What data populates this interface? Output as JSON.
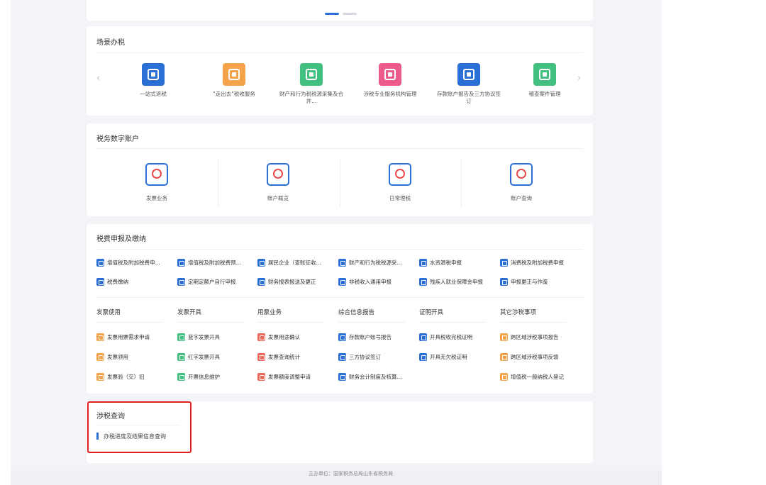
{
  "carousel": {
    "dots": [
      {
        "color": "#2a6fd6"
      },
      {
        "color": "#d4d8de"
      }
    ]
  },
  "scene": {
    "title": "场景办税",
    "items": [
      {
        "label": "一站式退税",
        "icon": "tax-refund-icon",
        "color": "#2a6fd6"
      },
      {
        "label": "\"走出去\"税收服务",
        "icon": "going-global-icon",
        "color": "#f5a34a"
      },
      {
        "label": "财产和行为税税源采集及合并...",
        "icon": "property-tax-icon",
        "color": "#42c07f"
      },
      {
        "label": "涉税专业服务机构管理",
        "icon": "institution-icon",
        "color": "#ec5a8e"
      },
      {
        "label": "存款账户报告及三方协议签订",
        "icon": "bank-account-icon",
        "color": "#2a6fd6"
      },
      {
        "label": "稽查案件管理",
        "icon": "case-management-icon",
        "color": "#42c07f"
      }
    ],
    "prev": "‹",
    "next": "›"
  },
  "account": {
    "title": "税务数字账户",
    "items": [
      {
        "label": "发票业务",
        "icon": "invoice-business-icon"
      },
      {
        "label": "账户概览",
        "icon": "account-overview-icon"
      },
      {
        "label": "日常理税",
        "icon": "daily-tax-icon"
      },
      {
        "label": "账户查询",
        "icon": "account-query-icon"
      }
    ]
  },
  "declare": {
    "title": "税费申报及缴纳",
    "row1": [
      {
        "label": "增值税及附加税费申...",
        "color": "#2a6fd6"
      },
      {
        "label": "增值税及附加税费预...",
        "color": "#2a6fd6"
      },
      {
        "label": "居民企业（查账征收...",
        "color": "#2a6fd6"
      },
      {
        "label": "财产和行为税税源采...",
        "color": "#2a6fd6"
      },
      {
        "label": "水资源税申报",
        "color": "#2a6fd6"
      },
      {
        "label": "消费税及附加税费申报",
        "color": "#2a6fd6"
      }
    ],
    "row2": [
      {
        "label": "税费缴纳",
        "color": "#2a6fd6"
      },
      {
        "label": "定期定额户自行申报",
        "color": "#2a6fd6"
      },
      {
        "label": "财务报表报送及更正",
        "color": "#2a6fd6"
      },
      {
        "label": "非税收入通用申报",
        "color": "#2a6fd6"
      },
      {
        "label": "残疾人就业保障金申报",
        "color": "#2a6fd6"
      },
      {
        "label": "申报更正与作废",
        "color": "#2a6fd6"
      }
    ],
    "columns": [
      "发票使用",
      "发票开具",
      "用票业务",
      "综合信息报告",
      "证明开具",
      "其它涉税事项"
    ],
    "col_items": [
      [
        {
          "label": "发票用票需求申请",
          "color": "#f5a34a"
        },
        {
          "label": "发票领用",
          "color": "#f5a34a"
        },
        {
          "label": "发票验（交）旧",
          "color": "#f5a34a"
        }
      ],
      [
        {
          "label": "蓝字发票开具",
          "color": "#42c07f"
        },
        {
          "label": "红字发票开具",
          "color": "#42c07f"
        },
        {
          "label": "开票信息维护",
          "color": "#42c07f"
        }
      ],
      [
        {
          "label": "发票用途确认",
          "color": "#ef6a5a"
        },
        {
          "label": "发票查询统计",
          "color": "#ef6a5a"
        },
        {
          "label": "发票额度调整申请",
          "color": "#ef6a5a"
        }
      ],
      [
        {
          "label": "存款账户账号报告",
          "color": "#2a6fd6"
        },
        {
          "label": "三方协议签订",
          "color": "#2a6fd6"
        },
        {
          "label": "财务会计制度及核算...",
          "color": "#2a6fd6"
        }
      ],
      [
        {
          "label": "开具税收完税证明",
          "color": "#2a6fd6"
        },
        {
          "label": "开具无欠税证明",
          "color": "#2a6fd6"
        }
      ],
      [
        {
          "label": "跨区域涉税事项报告",
          "color": "#f5a34a"
        },
        {
          "label": "跨区域涉税事项反馈",
          "color": "#f5a34a"
        },
        {
          "label": "增值税一般纳税人登记",
          "color": "#f5a34a"
        }
      ]
    ]
  },
  "query": {
    "title": "涉税查询",
    "item": "办税进度及结果信息查询"
  },
  "footer": {
    "text": "主办单位：国家税务总局山东省税务局"
  }
}
